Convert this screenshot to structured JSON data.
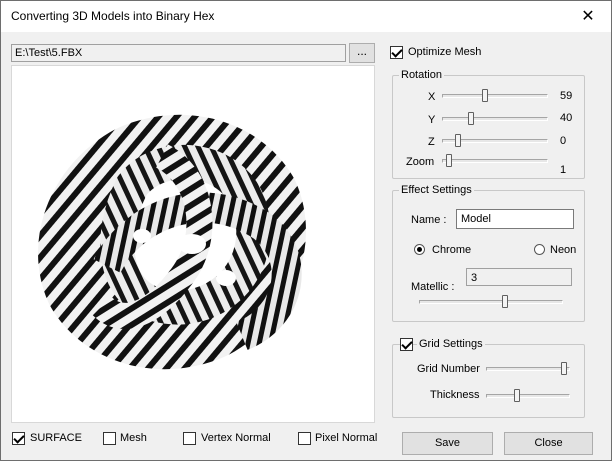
{
  "window": {
    "title": "Converting 3D Models into Binary Hex",
    "close_glyph": "✕"
  },
  "file": {
    "path": "E:\\Test\\5.FBX",
    "browse_label": "..."
  },
  "optimize_mesh": {
    "label": "Optimize Mesh",
    "checked": true
  },
  "rotation": {
    "title": "Rotation",
    "x": {
      "label": "X",
      "value": "59",
      "fraction": 0.4
    },
    "y": {
      "label": "Y",
      "value": "40",
      "fraction": 0.26
    },
    "z": {
      "label": "Z",
      "value": "0",
      "fraction": 0.12
    },
    "zoom": {
      "label": "Zoom",
      "value": "1",
      "fraction": 0.03
    }
  },
  "effect": {
    "title": "Effect Settings",
    "name_label": "Name :",
    "name_value": "Model",
    "chrome_label": "Chrome",
    "neon_label": "Neon",
    "selected": "chrome",
    "metallic_label": "Matellic :",
    "metallic_value": "3",
    "metallic_fraction": 0.6
  },
  "grid": {
    "title": "Grid Settings",
    "enabled": true,
    "number_label": "Grid Number",
    "number_fraction": 0.98,
    "thickness_label": "Thickness",
    "thickness_fraction": 0.35
  },
  "render_modes": [
    {
      "label": "SURFACE",
      "checked": true
    },
    {
      "label": "Mesh",
      "checked": false
    },
    {
      "label": "Vertex Normal",
      "checked": false
    },
    {
      "label": "Pixel Normal",
      "checked": false
    }
  ],
  "buttons": {
    "save": "Save",
    "close": "Close"
  },
  "colors": {
    "window_bg": "#f0f0f0",
    "stripe_dark": "#111111",
    "stripe_light": "#f2f2f2"
  }
}
